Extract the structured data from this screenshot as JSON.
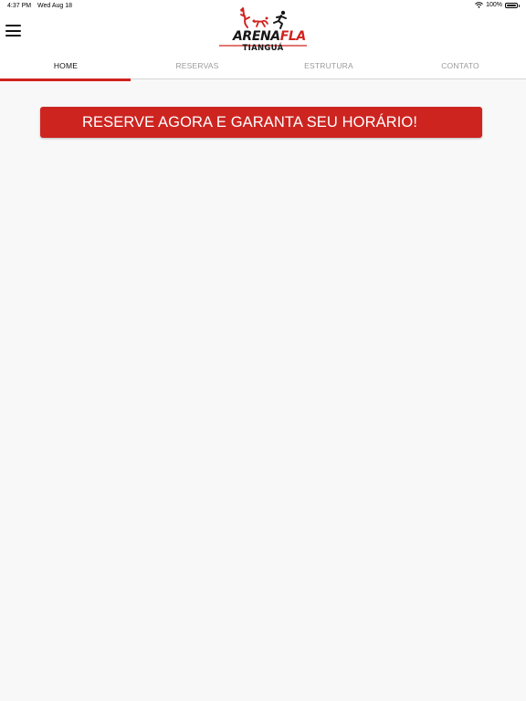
{
  "status_bar": {
    "time": "4:37 PM",
    "date": "Wed Aug 18",
    "battery": "100%",
    "wifi_icon": "wifi-icon",
    "battery_icon": "battery-icon"
  },
  "header": {
    "menu_icon": "hamburger-menu-icon",
    "logo": {
      "word_part1": "ARENA",
      "word_part2": "FLA",
      "city": "TIANGUÁ"
    }
  },
  "tabs": [
    {
      "label": "HOME",
      "active": true
    },
    {
      "label": "RESERVAS",
      "active": false
    },
    {
      "label": "ESTRUTURA",
      "active": false
    },
    {
      "label": "CONTATO",
      "active": false
    }
  ],
  "colors": {
    "brand_red": "#d0231f",
    "tab_inactive": "#9a9a9a",
    "background": "#f8f8f8"
  },
  "cta": {
    "label": "RESERVE AGORA E GARANTA SEU HORÁRIO!"
  }
}
